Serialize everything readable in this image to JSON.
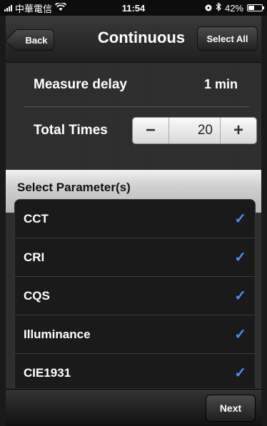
{
  "status_bar": {
    "carrier": "中華電信",
    "time": "11:54",
    "battery": "42%",
    "icons": [
      "signal-icon",
      "wifi-icon",
      "location-icon",
      "bluetooth-icon",
      "battery-icon"
    ]
  },
  "nav": {
    "back_label": "Back",
    "title": "Continuous",
    "select_all_label": "Select All"
  },
  "settings": {
    "measure_delay_label": "Measure delay",
    "measure_delay_value": "1 min",
    "total_times_label": "Total Times",
    "total_times_value": "20",
    "decrement": "−",
    "increment": "+"
  },
  "parameters": {
    "header": "Select Parameter(s)",
    "items": [
      {
        "label": "CCT",
        "checked": true
      },
      {
        "label": "CRI",
        "checked": true
      },
      {
        "label": "CQS",
        "checked": true
      },
      {
        "label": "Illuminance",
        "checked": true
      },
      {
        "label": "CIE1931",
        "checked": true
      }
    ],
    "check_glyph": "✓",
    "check_color": "#4a8ef3"
  },
  "footer": {
    "next_label": "Next"
  }
}
